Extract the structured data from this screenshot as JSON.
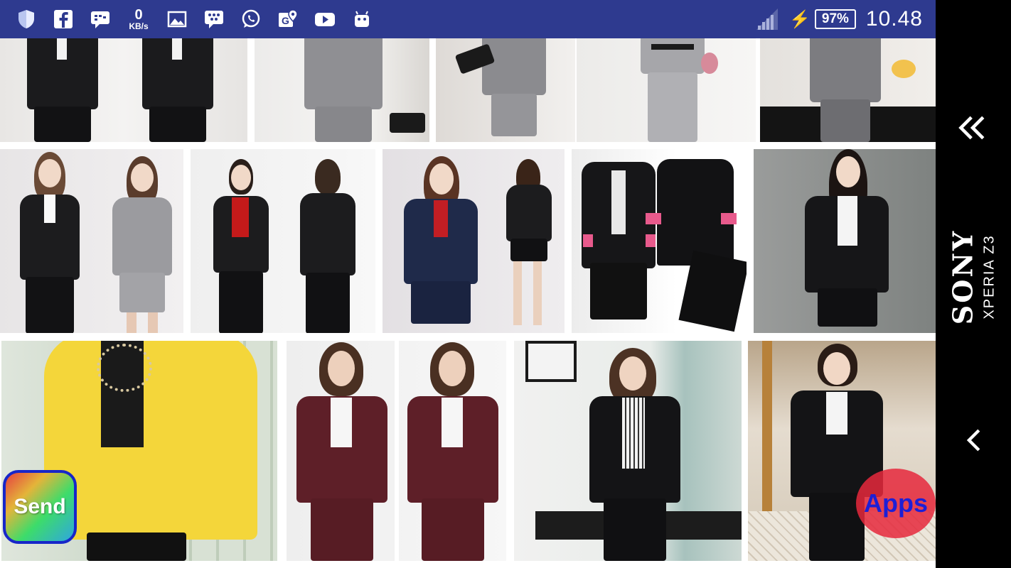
{
  "status_bar": {
    "background": "#2e3a8f",
    "icons_left": [
      "shield-icon",
      "facebook-icon",
      "bbm-icon",
      "network-speed",
      "gallery-icon",
      "blackberry-icon",
      "whatsapp-icon",
      "maps-icon",
      "youtube-icon",
      "android-icon"
    ],
    "net_speed_value": "0",
    "net_speed_unit": "KB/s",
    "battery_percent": "97%",
    "time": "10.48"
  },
  "nav": {
    "brand": "SONY",
    "model": "XPERIA Z3"
  },
  "gallery": {
    "tile_count": 14
  },
  "buttons": {
    "send_label": "Send",
    "apps_label": "Apps"
  }
}
